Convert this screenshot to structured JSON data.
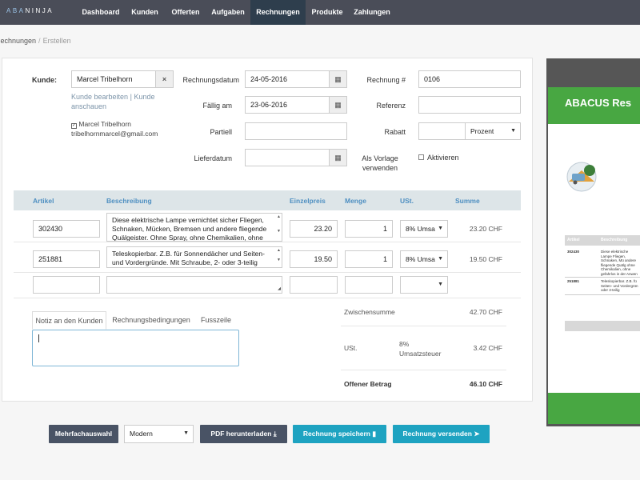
{
  "nav": {
    "logo_left": "ABA",
    "logo_right": "NINJA",
    "items": [
      {
        "label": "Dashboard"
      },
      {
        "label": "Kunden"
      },
      {
        "label": "Offerten"
      },
      {
        "label": "Aufgaben"
      },
      {
        "label": "Rechnungen"
      },
      {
        "label": "Produkte"
      },
      {
        "label": "Zahlungen"
      }
    ],
    "active": "Rechnungen"
  },
  "breadcrumb": {
    "parent": "Rechnungen",
    "separator": "/",
    "current": "Erstellen"
  },
  "client": {
    "label": "Kunde:",
    "value": "Marcel Tribelhorn",
    "clear_icon": "×",
    "edit_link": "Kunde bearbeiten",
    "divider": "|",
    "view_link_part1": "Kunde",
    "view_link_part2": "anschauen",
    "contact_name": "Marcel Tribelhorn",
    "contact_email": "tribelhornmarcel@gmail.com"
  },
  "dates": {
    "invoice_date_label": "Rechnungsdatum",
    "invoice_date": "24-05-2016",
    "due_label": "Fällig am",
    "due_date": "23-06-2016",
    "partial_label": "Partiell",
    "partial_value": "",
    "delivery_label": "Lieferdatum",
    "delivery_value": ""
  },
  "meta": {
    "invoice_no_label": "Rechnung #",
    "invoice_no": "0106",
    "reference_label": "Referenz",
    "reference_value": "",
    "discount_label": "Rabatt",
    "discount_value": "",
    "discount_type": "Prozent",
    "template_label_1": "Als Vorlage",
    "template_label_2": "verwenden",
    "activate_label": "Aktivieren"
  },
  "table": {
    "headers": {
      "article": "Artikel",
      "description": "Beschreibung",
      "unit_price": "Einzelpreis",
      "quantity": "Menge",
      "tax": "USt.",
      "total": "Summe"
    },
    "rows": [
      {
        "article": "302430",
        "description": "Diese elektrische Lampe vernichtet sicher Fliegen, Schnaken, Mücken, Bremsen und andere fliegende Quälgeister. Ohne Spray, ohne Chemikalien, ohne",
        "unit_price": "23.20",
        "quantity": "1",
        "tax": "8% Umsa",
        "total": "23.20 CHF"
      },
      {
        "article": "251881",
        "description": "Teleskopierbar. Z.B. für Sonnendächer und Seiten- und Vordergründe. Mit Schraube, 2- oder 3-teilig",
        "unit_price": "19.50",
        "quantity": "1",
        "tax": "8% Umsa",
        "total": "19.50 CHF"
      }
    ]
  },
  "notes": {
    "tabs": [
      "Notiz an den Kunden",
      "Rechnungsbedingungen",
      "Fusszeile"
    ],
    "active_tab": "Notiz an den Kunden"
  },
  "totals": {
    "subtotal_label": "Zwischensumme",
    "subtotal": "42.70 CHF",
    "tax_label": "USt.",
    "tax_rate": "8%",
    "tax_name": "Umsatzsteuer",
    "tax_amount": "3.42 CHF",
    "balance_label": "Offener Betrag",
    "balance": "46.10 CHF"
  },
  "actions": {
    "bulk": "Mehrfachauswahl",
    "design": "Modern",
    "pdf": "PDF herunterladen",
    "save": "Rechnung speichern",
    "send": "Rechnung versenden"
  },
  "preview": {
    "title": "ABACUS Res",
    "head_article": "Artikel",
    "head_desc": "Beschreibung",
    "row1_article": "302430",
    "row1_desc": "Diese elektrische Lampe Fliegen, Schnaken, Mü andere fliegende Quälg ohne Chemikalien, ohne gefahrlos in der Anwen",
    "row2_article": "251881",
    "row2_desc": "Teleskopierbar. Z.B. fü Seiten- und Vordergrün oder 3-teilig"
  },
  "colors": {
    "nav_bg": "#4a4d58",
    "nav_active": "#2e3e4d",
    "accent": "#1ea3c1",
    "dark_button": "#495365",
    "preview_green": "#48a742"
  }
}
